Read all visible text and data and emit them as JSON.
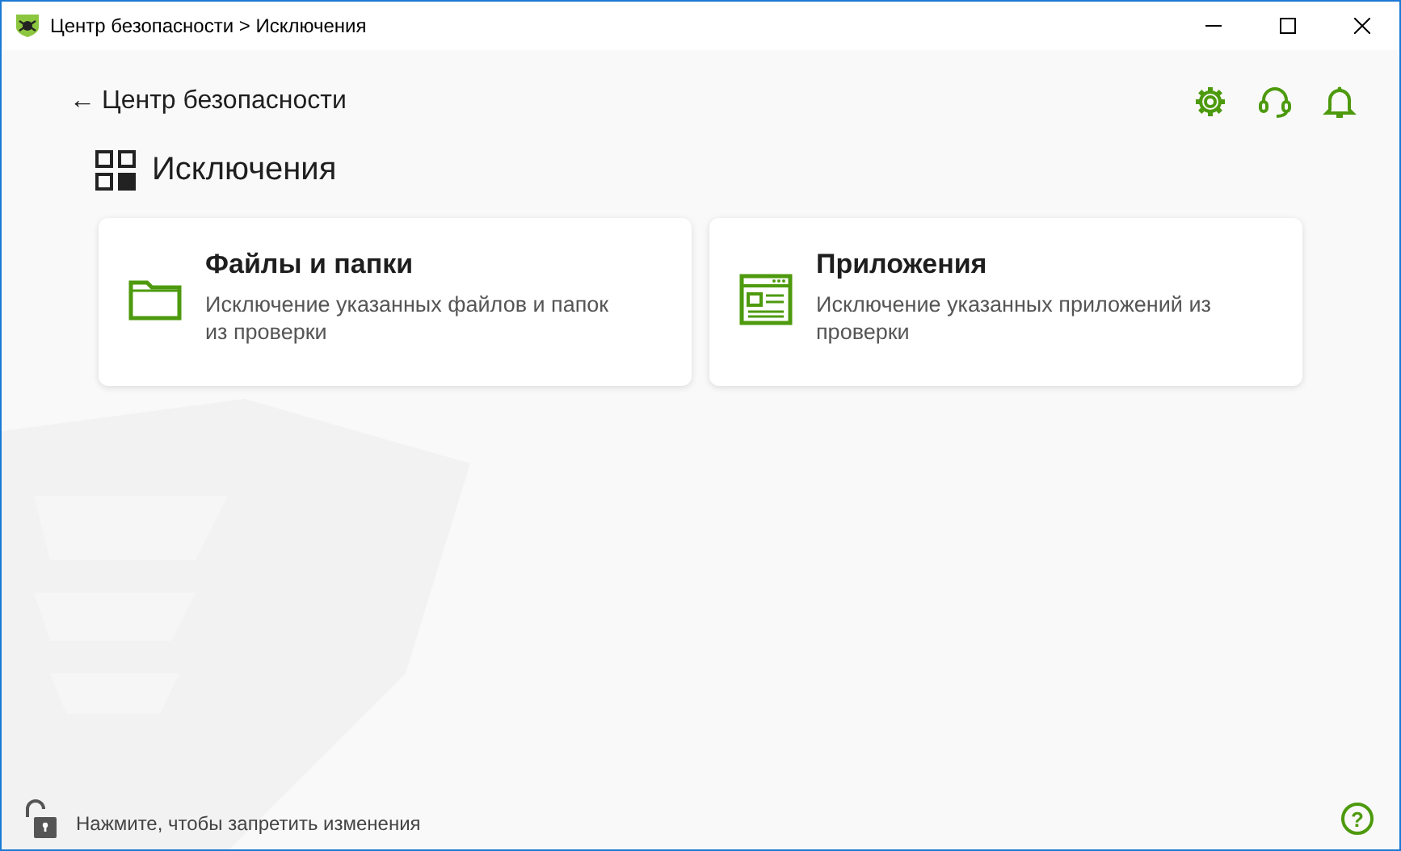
{
  "window": {
    "title": "Центр безопасности > Исключения"
  },
  "back_link": {
    "arrow": "←",
    "label": "Центр безопасности"
  },
  "page_title": "Исключения",
  "cards": [
    {
      "kind": "folder",
      "title": "Файлы и папки",
      "description": "Исключение указанных файлов и папок из проверки"
    },
    {
      "kind": "app",
      "title": "Приложения",
      "description": "Исключение указанных приложений из проверки"
    }
  ],
  "status_bar": {
    "text": "Нажмите, чтобы запретить изменения",
    "help": "?"
  }
}
